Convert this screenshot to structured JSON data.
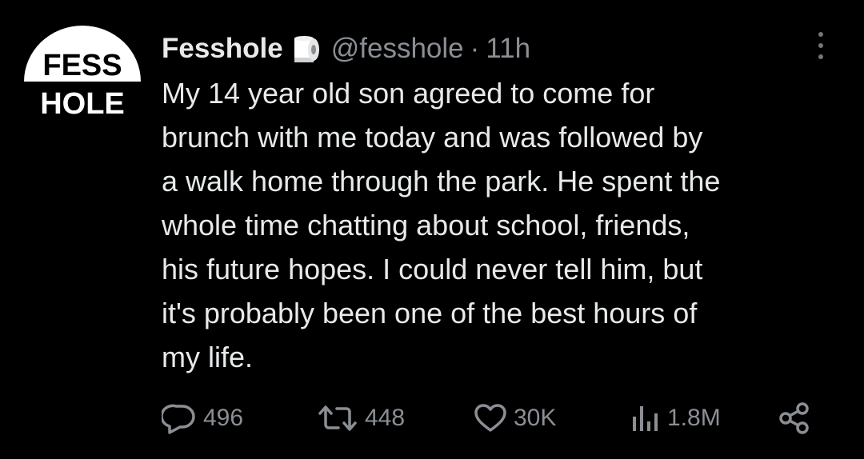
{
  "account": {
    "avatar_line1": "FESS",
    "avatar_line2": "HOLE",
    "display_name": "Fesshole",
    "badge_icon": "toilet-paper-icon",
    "handle": "@fesshole",
    "separator": "·",
    "time": "11h"
  },
  "tweet": {
    "lines": [
      "My 14 year old son agreed to come for",
      "brunch with me today and was followed by",
      "a walk home through the park. He spent the",
      "whole time chatting about school, friends,",
      "his future hopes. I could never tell him, but",
      "it's probably been one of the best hours of",
      "my life."
    ]
  },
  "actions": {
    "reply": {
      "icon": "reply-icon",
      "count": "496"
    },
    "retweet": {
      "icon": "retweet-icon",
      "count": "448"
    },
    "like": {
      "icon": "heart-icon",
      "count": "30K"
    },
    "views": {
      "icon": "views-chart-icon",
      "count": "1.8M"
    },
    "share": {
      "icon": "share-icon"
    }
  },
  "colors": {
    "background": "#000000",
    "text": "#e7e9ea",
    "secondary": "#8b8f94"
  }
}
